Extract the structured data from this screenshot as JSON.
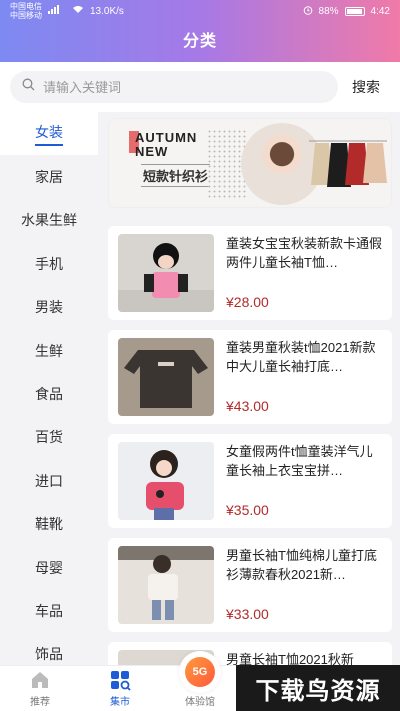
{
  "status_bar": {
    "carrier_1": "中国电信",
    "carrier_2": "中国移动",
    "network_speed": "13.0K/s",
    "battery": "88%",
    "time": "4:42"
  },
  "header": {
    "title": "分类"
  },
  "search": {
    "placeholder": "请输入关键词",
    "button_label": "搜索"
  },
  "sidebar": {
    "items": [
      {
        "label": "女装",
        "active": true
      },
      {
        "label": "家居"
      },
      {
        "label": "水果生鲜"
      },
      {
        "label": "手机"
      },
      {
        "label": "男装"
      },
      {
        "label": "生鲜"
      },
      {
        "label": "食品"
      },
      {
        "label": "百货"
      },
      {
        "label": "进口"
      },
      {
        "label": "鞋靴"
      },
      {
        "label": "母婴"
      },
      {
        "label": "车品"
      },
      {
        "label": "饰品"
      }
    ]
  },
  "banner": {
    "title_en_1": "AUTUMN",
    "title_en_2": "NEW",
    "title_cn": "短款针织衫"
  },
  "products": [
    {
      "name": "童装女宝宝秋装新款卡通假两件儿童长袖T恤…",
      "price": "¥28.00"
    },
    {
      "name": "童装男童秋装t恤2021新款中大儿童长袖打底…",
      "price": "¥43.00"
    },
    {
      "name": "女童假两件t恤童装洋气儿童长袖上衣宝宝拼…",
      "price": "¥35.00"
    },
    {
      "name": "男童长袖T恤纯棉儿童打底衫薄款春秋2021新…",
      "price": "¥33.00"
    },
    {
      "name": "男童长袖T恤2021秋新",
      "price": ""
    }
  ],
  "tabbar": {
    "items": [
      {
        "label": "推荐"
      },
      {
        "label": "集市",
        "active": true
      },
      {
        "label": "体验馆"
      }
    ],
    "badge_5g": "5G"
  },
  "watermark": "下载鸟资源",
  "colors": {
    "accent": "#1f5bd6",
    "price": "#b22a2a",
    "header_gradient_start": "#7d8af2",
    "header_gradient_end": "#f07aa8"
  }
}
